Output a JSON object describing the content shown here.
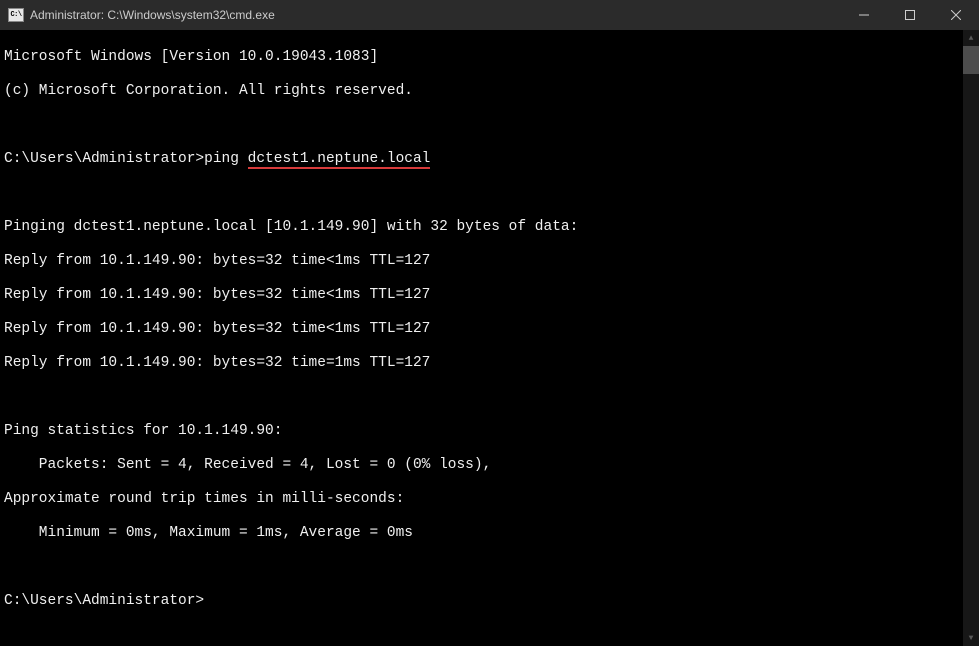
{
  "window": {
    "icon_text": "C:\\",
    "title": "Administrator: C:\\Windows\\system32\\cmd.exe"
  },
  "terminal": {
    "lines": {
      "l0": "Microsoft Windows [Version 10.0.19043.1083]",
      "l1": "(c) Microsoft Corporation. All rights reserved.",
      "l2": "",
      "l3_prompt": "C:\\Users\\Administrator>",
      "l3_cmd_prefix": "ping ",
      "l3_cmd_target": "dctest1.neptune.local",
      "l4": "",
      "l5": "Pinging dctest1.neptune.local [10.1.149.90] with 32 bytes of data:",
      "l6": "Reply from 10.1.149.90: bytes=32 time<1ms TTL=127",
      "l7": "Reply from 10.1.149.90: bytes=32 time<1ms TTL=127",
      "l8": "Reply from 10.1.149.90: bytes=32 time<1ms TTL=127",
      "l9": "Reply from 10.1.149.90: bytes=32 time=1ms TTL=127",
      "l10": "",
      "l11": "Ping statistics for 10.1.149.90:",
      "l12": "    Packets: Sent = 4, Received = 4, Lost = 0 (0% loss),",
      "l13": "Approximate round trip times in milli-seconds:",
      "l14": "    Minimum = 0ms, Maximum = 1ms, Average = 0ms",
      "l15": "",
      "l16": "C:\\Users\\Administrator>"
    }
  }
}
